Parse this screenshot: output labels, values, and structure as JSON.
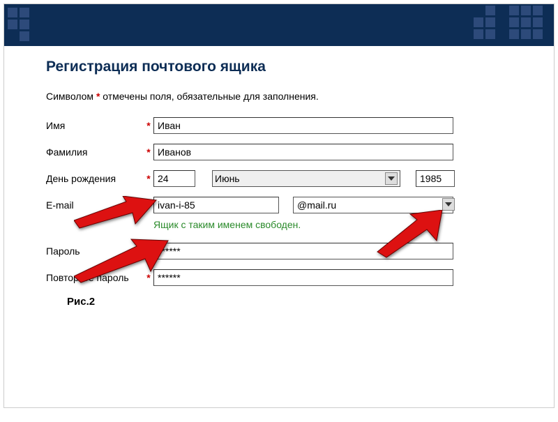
{
  "page": {
    "title": "Регистрация почтового ящика",
    "required_note_pre": "Символом ",
    "required_mark": "*",
    "required_note_post": " отмечены поля, обязательные для заполнения.",
    "caption": "Рис.2"
  },
  "form": {
    "first_name": {
      "label": "Имя",
      "value": "Иван"
    },
    "last_name": {
      "label": "Фамилия",
      "value": "Иванов"
    },
    "birthday": {
      "label": "День рождения",
      "day": "24",
      "month": "Июнь",
      "year": "1985"
    },
    "email": {
      "label": "E-mail",
      "value": "ivan-i-85",
      "domain": "@mail.ru",
      "availability": "Ящик с таким именем свободен."
    },
    "password": {
      "label": "Пароль",
      "value": "******"
    },
    "password2": {
      "label": "Повторите пароль",
      "value": "******"
    },
    "asterisk": "*"
  }
}
